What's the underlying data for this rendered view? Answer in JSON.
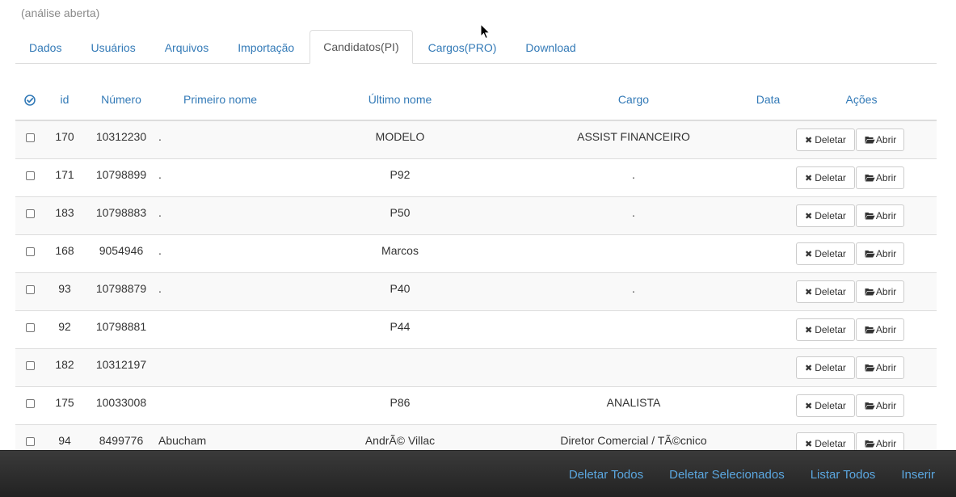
{
  "subtitle": "(análise aberta)",
  "tabs": [
    {
      "label": "Dados",
      "active": false
    },
    {
      "label": "Usuários",
      "active": false
    },
    {
      "label": "Arquivos",
      "active": false
    },
    {
      "label": "Importação",
      "active": false
    },
    {
      "label": "Candidatos(PI)",
      "active": true
    },
    {
      "label": "Cargos(PRO)",
      "active": false
    },
    {
      "label": "Download",
      "active": false
    }
  ],
  "table": {
    "select_all_icon": "check-circle-icon",
    "headers": {
      "id": "id",
      "numero": "Número",
      "primeiro_nome": "Primeiro nome",
      "ultimo_nome": "Último nome",
      "cargo": "Cargo",
      "data": "Data",
      "acoes": "Ações"
    },
    "delete_label": "Deletar",
    "open_label": "Abrir",
    "rows": [
      {
        "id": "170",
        "numero": "10312230",
        "primeiro_nome": ".",
        "ultimo_nome": "MODELO",
        "cargo": "ASSIST FINANCEIRO",
        "data": ""
      },
      {
        "id": "171",
        "numero": "10798899",
        "primeiro_nome": ".",
        "ultimo_nome": "P92",
        "cargo": ".",
        "data": ""
      },
      {
        "id": "183",
        "numero": "10798883",
        "primeiro_nome": ".",
        "ultimo_nome": "P50",
        "cargo": ".",
        "data": ""
      },
      {
        "id": "168",
        "numero": "9054946",
        "primeiro_nome": ".",
        "ultimo_nome": "Marcos",
        "cargo": "",
        "data": ""
      },
      {
        "id": "93",
        "numero": "10798879",
        "primeiro_nome": ".",
        "ultimo_nome": "P40",
        "cargo": ".",
        "data": ""
      },
      {
        "id": "92",
        "numero": "10798881",
        "primeiro_nome": "",
        "ultimo_nome": "P44",
        "cargo": "",
        "data": ""
      },
      {
        "id": "182",
        "numero": "10312197",
        "primeiro_nome": "",
        "ultimo_nome": "",
        "cargo": "",
        "data": ""
      },
      {
        "id": "175",
        "numero": "10033008",
        "primeiro_nome": "",
        "ultimo_nome": "P86",
        "cargo": "ANALISTA",
        "data": ""
      },
      {
        "id": "94",
        "numero": "8499776",
        "primeiro_nome": "Abucham",
        "ultimo_nome": "AndrÃ© Villac",
        "cargo": "Diretor Comercial / TÃ©cnico",
        "data": ""
      }
    ]
  },
  "footer": {
    "links": [
      "Deletar Todos",
      "Deletar Selecionados",
      "Listar Todos",
      "Inserir"
    ]
  },
  "colors": {
    "link": "#337ab7",
    "footer_link": "#5ba7e0",
    "footer_bg": "#2b2b2b"
  }
}
